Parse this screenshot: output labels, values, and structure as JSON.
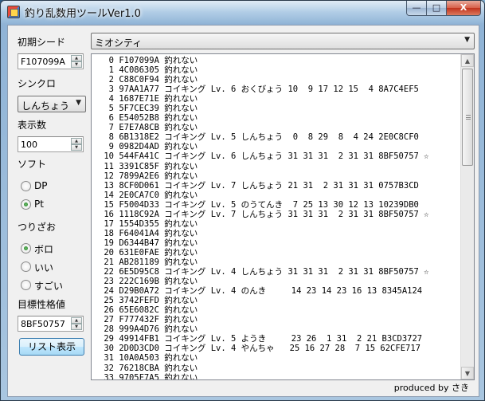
{
  "window": {
    "title": "釣り乱数用ツールVer1.0",
    "min_glyph": "—",
    "max_glyph": "□",
    "close_glyph": "X"
  },
  "left_panel": {
    "seed_label": "初期シード",
    "seed_value": "F107099A",
    "sync_label": "シンクロ",
    "sync_value": "しんちょう",
    "count_label": "表示数",
    "count_value": "100",
    "soft_label": "ソフト",
    "soft_options": [
      "DP",
      "Pt"
    ],
    "soft_selected": "Pt",
    "rod_label": "つりざお",
    "rod_options": [
      "ボロ",
      "いい",
      "すごい"
    ],
    "rod_selected": "ボロ",
    "target_label": "目標性格値",
    "target_value": "8BF50757",
    "list_button": "リスト表示"
  },
  "location": {
    "value": "ミオシティ"
  },
  "rows": [
    {
      "i": "0",
      "text": "F107099A 釣れない"
    },
    {
      "i": "1",
      "text": "4C086305 釣れない"
    },
    {
      "i": "2",
      "text": "C88C0F94 釣れない"
    },
    {
      "i": "3",
      "text": "97AA1A77 コイキング Lv. 6 おくびょう 10  9 17 12 15  4 8A7C4EF5"
    },
    {
      "i": "4",
      "text": "1687E71E 釣れない"
    },
    {
      "i": "5",
      "text": "5F7CEC39 釣れない"
    },
    {
      "i": "6",
      "text": "E54052B8 釣れない"
    },
    {
      "i": "7",
      "text": "E7E7A8CB 釣れない"
    },
    {
      "i": "8",
      "text": "6B1318E2 コイキング Lv. 5 しんちょう  0  8 29  8  4 24 2E0C8CF0"
    },
    {
      "i": "9",
      "text": "0982D4AD 釣れない"
    },
    {
      "i": "10",
      "text": "544FA41C コイキング Lv. 6 しんちょう 31 31 31  2 31 31 8BF50757 ☆"
    },
    {
      "i": "11",
      "text": "3391C85F 釣れない"
    },
    {
      "i": "12",
      "text": "7899A2E6 釣れない"
    },
    {
      "i": "13",
      "text": "8CF0D061 コイキング Lv. 7 しんちょう 21 31  2 31 31 31 0757B3CD"
    },
    {
      "i": "14",
      "text": "2E0CA7C0 釣れない"
    },
    {
      "i": "15",
      "text": "F5004D33 コイキング Lv. 5 のうてんき  7 25 13 30 12 13 10239DB0"
    },
    {
      "i": "16",
      "text": "1118C92A コイキング Lv. 7 しんちょう 31 31 31  2 31 31 8BF50757 ☆"
    },
    {
      "i": "17",
      "text": "1554D355 釣れない"
    },
    {
      "i": "18",
      "text": "F64041A4 釣れない"
    },
    {
      "i": "19",
      "text": "D6344B47 釣れない"
    },
    {
      "i": "20",
      "text": "631E0FAE 釣れない"
    },
    {
      "i": "21",
      "text": "AB281189 釣れない"
    },
    {
      "i": "22",
      "text": "6E5D95C8 コイキング Lv. 4 しんちょう 31 31 31  2 31 31 8BF50757 ☆"
    },
    {
      "i": "23",
      "text": "222C169B 釣れない"
    },
    {
      "i": "24",
      "text": "D29B0A72 コイキング Lv. 4 のんき     14 23 14 23 16 13 8345A124"
    },
    {
      "i": "25",
      "text": "3742FEFD 釣れない"
    },
    {
      "i": "26",
      "text": "65E6082C 釣れない"
    },
    {
      "i": "27",
      "text": "F777432F 釣れない"
    },
    {
      "i": "28",
      "text": "999A4D76 釣れない"
    },
    {
      "i": "29",
      "text": "49914FB1 コイキング Lv. 5 ようき     23 26  1 31  2 21 B3CD3727"
    },
    {
      "i": "30",
      "text": "2D0D3CD0 コイキング Lv. 4 やんちゃ   25 16 27 28  7 15 62CFE717"
    },
    {
      "i": "31",
      "text": "10A0A503 釣れない"
    },
    {
      "i": "32",
      "text": "76218CBA 釣れない"
    },
    {
      "i": "33",
      "text": "9705F7A5 釣れない"
    }
  ],
  "footer": "produced by さき"
}
